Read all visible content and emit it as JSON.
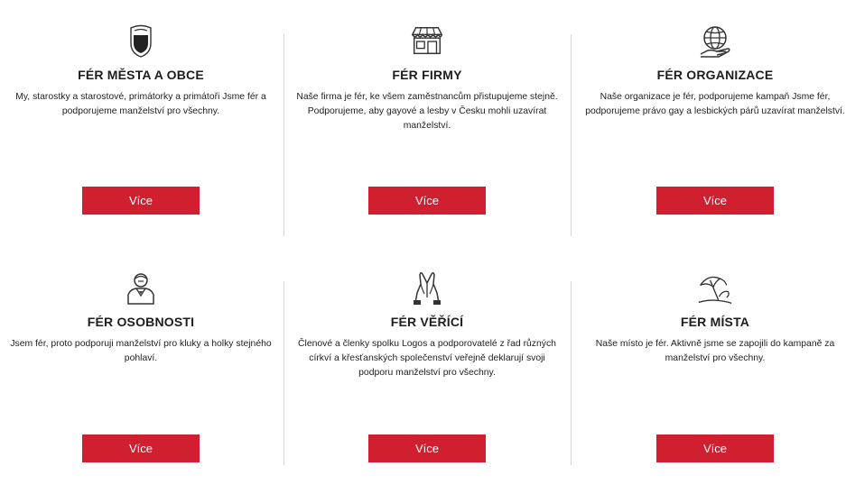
{
  "cards": [
    {
      "title": "FÉR MĚSTA A OBCE",
      "desc": "My, starostky a starostové, primátorky a primátoři Jsme fér a podporujeme manželství pro všechny.",
      "button": "Více",
      "icon": "coat-of-arms-icon"
    },
    {
      "title": "FÉR FIRMY",
      "desc": "Naše firma je fér, ke všem zaměstnancům přistupujeme stejně. Podporujeme, aby gayové a lesby v Česku mohli uzavírat manželství.",
      "button": "Více",
      "icon": "storefront-icon"
    },
    {
      "title": "FÉR ORGANIZACE",
      "desc": "Naše organizace je fér, podporujeme kampaň Jsme fér, podporujeme právo gay a lesbických párů uzavírat manželství.",
      "button": "Více",
      "icon": "globe-hand-icon"
    },
    {
      "title": "FÉR OSOBNOSTI",
      "desc": "Jsem fér, proto podporuji manželství pro kluky a holky stejného pohlaví.",
      "button": "Více",
      "icon": "person-bust-icon"
    },
    {
      "title": "FÉR VĚŘÍCÍ",
      "desc": "Členové a členky spolku Logos a podporovatelé z řad různých církví a křesťanských společenství veřejně deklarují svoji podporu manželství pro všechny.",
      "button": "Více",
      "icon": "praying-hands-icon"
    },
    {
      "title": "FÉR MÍSTA",
      "desc": "Naše místo je fér. Aktivně jsme se zapojili do kampaně za manželství pro všechny.",
      "button": "Více",
      "icon": "beach-umbrella-icon"
    }
  ],
  "colors": {
    "button_bg": "#d01f2e",
    "divider": "#d6d6d6",
    "icon_stroke": "#333333"
  }
}
